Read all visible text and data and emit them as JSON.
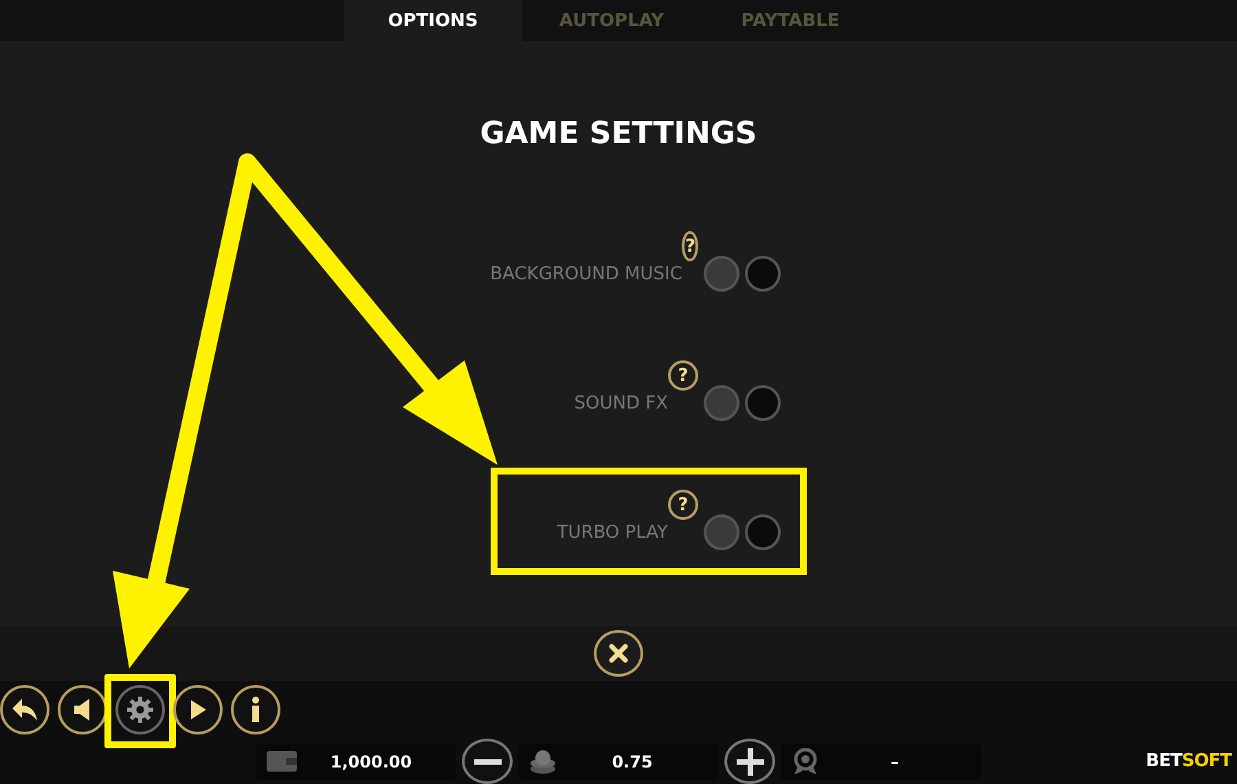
{
  "tabs": [
    {
      "label": "OPTIONS",
      "selected": true
    },
    {
      "label": "AUTOPLAY",
      "selected": false
    },
    {
      "label": "PAYTABLE",
      "selected": false
    }
  ],
  "title": "GAME SETTINGS",
  "settings": [
    {
      "label": "BACKGROUND MUSIC",
      "help": "?",
      "on": false,
      "highlighted": false
    },
    {
      "label": "SOUND FX",
      "help": "?",
      "on": false,
      "highlighted": false
    },
    {
      "label": "TURBO PLAY",
      "help": "?",
      "on": false,
      "highlighted": true
    }
  ],
  "controls": [
    {
      "kind": "back",
      "selected": false,
      "highlighted": false
    },
    {
      "kind": "sound",
      "selected": false,
      "highlighted": false
    },
    {
      "kind": "settings",
      "selected": true,
      "highlighted": true
    },
    {
      "kind": "autoplay",
      "selected": false,
      "highlighted": false
    },
    {
      "kind": "info",
      "selected": false,
      "highlighted": false
    }
  ],
  "balance": "1,000.00",
  "bet": "0.75",
  "win": "–",
  "logo": [
    "BET",
    "SOFT"
  ]
}
